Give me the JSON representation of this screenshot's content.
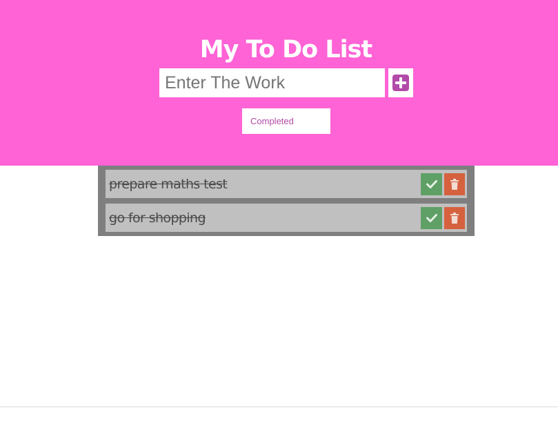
{
  "header": {
    "title": "My To Do List",
    "input_placeholder": "Enter The Work",
    "input_value": "",
    "add_icon": "plus-square-icon",
    "filter_selected": "Completed",
    "background_color": "#ff63d6",
    "accent_color": "#b24aa8"
  },
  "todos": [
    {
      "text": "prepare maths test",
      "completed": true
    },
    {
      "text": "go for shopping",
      "completed": true
    }
  ],
  "item_icons": {
    "complete": "check-icon",
    "delete": "trash-icon"
  },
  "colors": {
    "list_background": "#7f7f7f",
    "item_background": "#c0c0c0",
    "complete_button": "#5fa066",
    "delete_button": "#d6613f"
  }
}
